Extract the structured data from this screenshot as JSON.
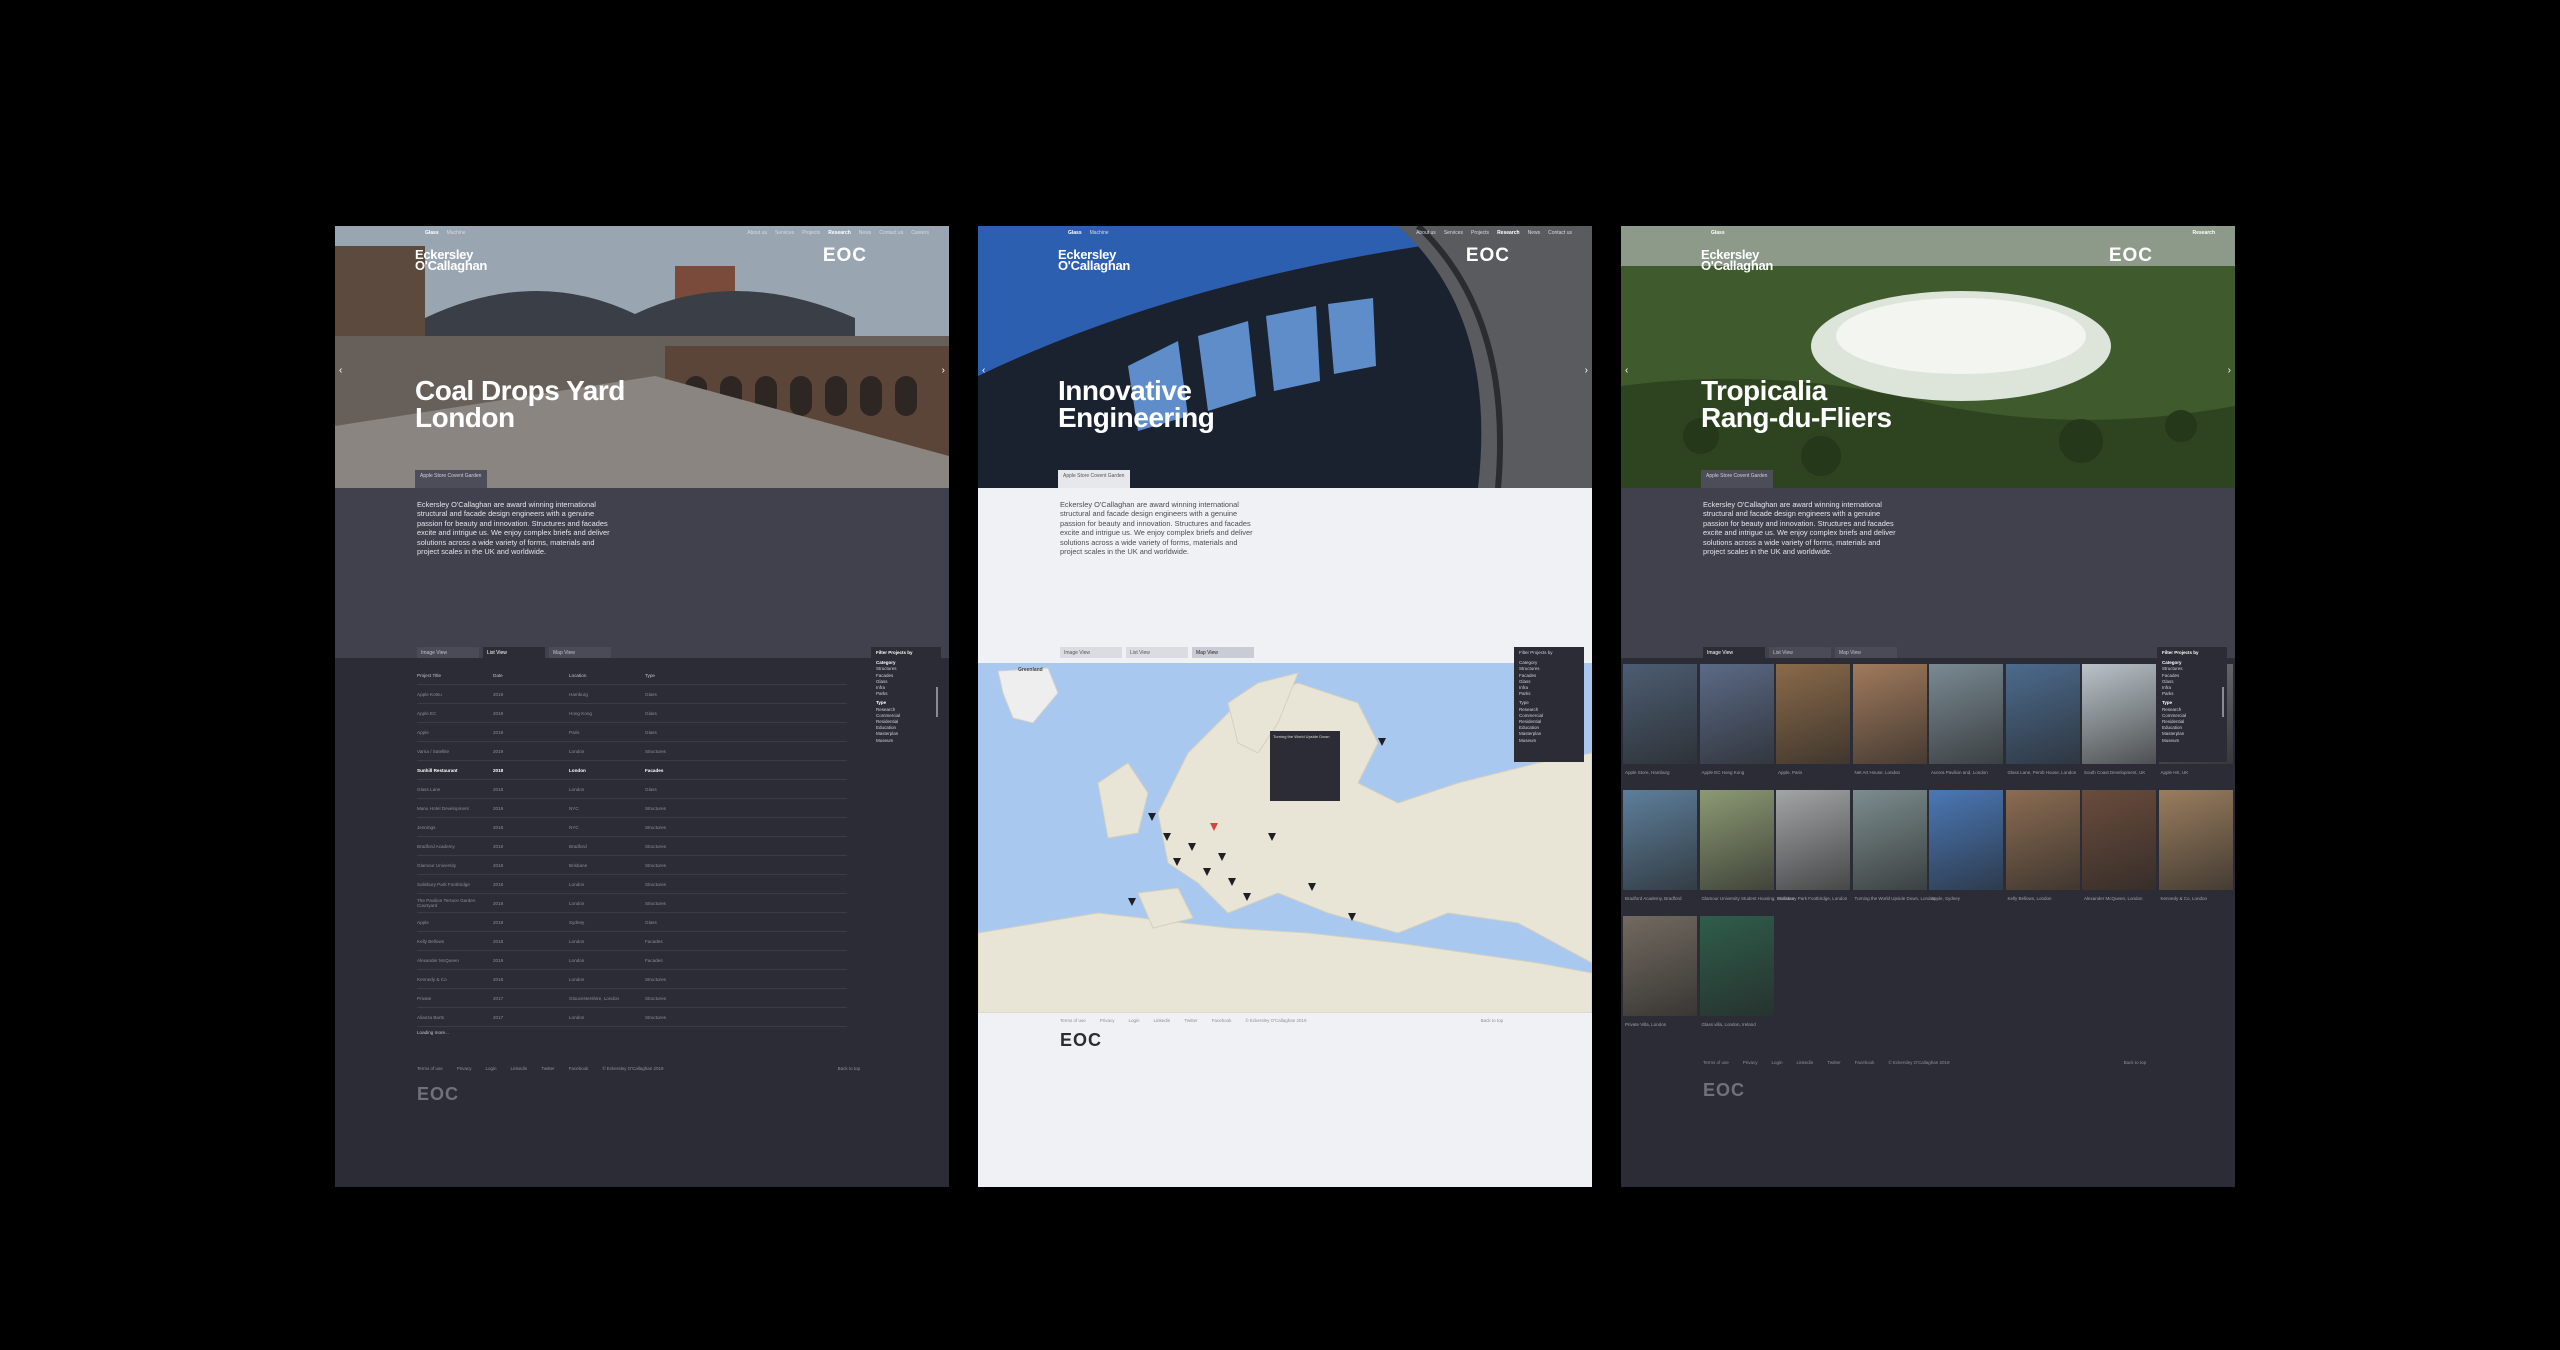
{
  "panels": [
    {
      "nav": {
        "lang": [
          "Glass",
          "Machine"
        ],
        "menu": [
          "About us",
          "Services",
          "Projects",
          "Research",
          "News",
          "Contact us",
          "Careers"
        ],
        "active_menu": "Research"
      },
      "brand": "Eckersley O'Callaghan",
      "logo": "EOC",
      "title_line1": "Coal Drops Yard",
      "title_line2": "London",
      "tag": "Apple Store Covent Garden",
      "intro": "Eckersley O'Callaghan are award winning international structural and facade design engineers with a genuine passion for beauty and innovation. Structures and facades excite and intrigue us. We enjoy complex briefs and deliver solutions across a wide variety of forms, materials and project scales in the UK and worldwide.",
      "toolbar": [
        "Image View",
        "List View",
        "Map View"
      ],
      "list": {
        "headers": [
          "Project Title",
          "Date",
          "Location",
          "Type"
        ],
        "rows": [
          [
            "Apple Kotsu",
            "2019",
            "Hamburg",
            "Glass"
          ],
          [
            "Apple EC",
            "2019",
            "Hong Kong",
            "Glass"
          ],
          [
            "Apple",
            "2019",
            "Paris",
            "Glass"
          ],
          [
            "Varna / Satellite",
            "2019",
            "London",
            "Structures"
          ],
          [
            "Sunhill Restaurant",
            "2018",
            "London",
            "Facades"
          ],
          [
            "Glass Lane",
            "2018",
            "London",
            "Glass"
          ],
          [
            "Manu Hotel Development",
            "2018",
            "NYC",
            "Structures"
          ],
          [
            "Jennings",
            "2018",
            "NYC",
            "Structures"
          ],
          [
            "Bradford Academy",
            "2018",
            "Bradford",
            "Structures"
          ],
          [
            "Glamour University",
            "2018",
            "Brisbane",
            "Structures"
          ],
          [
            "Salisbury Park Footbridge",
            "2018",
            "London",
            "Structures"
          ],
          [
            "The Pavilion Terrace Garden Courtyard",
            "2018",
            "London",
            "Structures"
          ],
          [
            "Apple",
            "2018",
            "Sydney",
            "Glass"
          ],
          [
            "Kelly Bellows",
            "2018",
            "London",
            "Facades"
          ],
          [
            "Alexander McQueen",
            "2018",
            "London",
            "Facades"
          ],
          [
            "Kennedy & Co",
            "2018",
            "London",
            "Structures"
          ],
          [
            "Private",
            "2017",
            "Gloucestershire, London",
            "Structures"
          ],
          [
            "Alianza Barts",
            "2017",
            "London",
            "Structures"
          ]
        ],
        "highlight_index": 4,
        "loading": "Loading more..."
      },
      "filter": {
        "title": "Filter Projects by",
        "groups": [
          {
            "h": "Category",
            "items": [
              "Structures",
              "Facades",
              "Glass",
              "Infra",
              "Parks"
            ]
          },
          {
            "h": "Type",
            "items": [
              "Research",
              "Commercial",
              "Residential",
              "Education",
              "Masterplan",
              "Museum"
            ]
          }
        ]
      },
      "footer": {
        "links": [
          "Terms of use",
          "Privacy",
          "Login",
          "Linkedin",
          "Twitter",
          "Facebook",
          "© Eckersley O'Callaghan 2019",
          "Back to top"
        ]
      },
      "footer_logo": "EOC"
    },
    {
      "nav": {
        "lang": [
          "Glass",
          "Machine"
        ],
        "menu": [
          "About us",
          "Services",
          "Projects",
          "Research",
          "News",
          "Contact us"
        ],
        "active_menu": "Research"
      },
      "brand": "Eckersley O'Callaghan",
      "logo": "EOC",
      "title_line1": "Innovative",
      "title_line2": "Engineering",
      "tag": "Apple Store Covent Garden",
      "intro": "Eckersley O'Callaghan are award winning international structural and facade design engineers with a genuine passion for beauty and innovation. Structures and facades excite and intrigue us. We enjoy complex briefs and deliver solutions across a wide variety of forms, materials and project scales in the UK and worldwide.",
      "toolbar": [
        "Image View",
        "List View",
        "Map View"
      ],
      "map_legend": "Greenland",
      "map_popup": "Turning the World Upside Down",
      "filter": {
        "title": "Filter Projects by",
        "groups": [
          {
            "h": "Category",
            "items": [
              "Structures",
              "Facades",
              "Glass",
              "Infra",
              "Parks"
            ]
          },
          {
            "h": "Type",
            "items": [
              "Research",
              "Commercial",
              "Residential",
              "Education",
              "Masterplan",
              "Museum"
            ]
          }
        ]
      },
      "footer": {
        "links": [
          "Terms of use",
          "Privacy",
          "Login",
          "Linkedin",
          "Twitter",
          "Facebook",
          "© Eckersley O'Callaghan 2019",
          "Back to top"
        ]
      },
      "footer_logo": "EOC"
    },
    {
      "nav": {
        "lang": [
          "Glass"
        ],
        "menu": [
          "Research"
        ],
        "active_menu": "Research"
      },
      "brand": "Eckersley O'Callaghan",
      "logo": "EOC",
      "title_line1": "Tropicalia",
      "title_line2": "Rang-du-Fliers",
      "tag": "Apple Store Covent Garden",
      "intro": "Eckersley O'Callaghan are award winning international structural and facade design engineers with a genuine passion for beauty and innovation. Structures and facades excite and intrigue us. We enjoy complex briefs and deliver solutions across a wide variety of forms, materials and project scales in the UK and worldwide.",
      "toolbar": [
        "Image View",
        "List View",
        "Map View"
      ],
      "tiles": [
        {
          "caption": "Apple Store, Hamburg",
          "color": "#4c5d72"
        },
        {
          "caption": "Apple EC Hong Kong",
          "color": "#5b6a86"
        },
        {
          "caption": "Apple, Paris",
          "color": "#8a6a4a"
        },
        {
          "caption": "Net Art House, London",
          "color": "#a07a5c"
        },
        {
          "caption": "Aurora Pavilion and, London",
          "color": "#7a8a93"
        },
        {
          "caption": "Glass Lane, Pemb House, London",
          "color": "#4c6b8e"
        },
        {
          "caption": "South Coast Development, UK",
          "color": "#b9c3c9"
        },
        {
          "caption": "Apple HK, UK",
          "color": "#6d6f75"
        },
        {
          "caption": "Bradford Academy, Bradford",
          "color": "#5d7f9b"
        },
        {
          "caption": "Glamour University Student Housing, Brisbane",
          "color": "#8c9a74"
        },
        {
          "caption": "Salisbury Park Footbridge, London",
          "color": "#a2a5a6"
        },
        {
          "caption": "Turning the World Upside Down, London",
          "color": "#7c8d8f"
        },
        {
          "caption": "Apple, Sydney",
          "color": "#4a78b6"
        },
        {
          "caption": "Kelly Bellows, London",
          "color": "#8b6c52"
        },
        {
          "caption": "Alexander McQueen, London",
          "color": "#6a4c3c"
        },
        {
          "caption": "Kennedy & Co, London",
          "color": "#9a7d5e"
        },
        {
          "caption": "Private Villa, London",
          "color": "#726a60"
        },
        {
          "caption": "Glass villa, London, Ireland",
          "color": "#2f5d4c"
        }
      ],
      "filter": {
        "title": "Filter Projects by",
        "groups": [
          {
            "h": "Category",
            "items": [
              "Structures",
              "Facades",
              "Glass",
              "Infra",
              "Parks"
            ]
          },
          {
            "h": "Type",
            "items": [
              "Research",
              "Commercial",
              "Residential",
              "Education",
              "Masterplan",
              "Museum"
            ]
          }
        ]
      },
      "footer": {
        "links": [
          "Terms of use",
          "Privacy",
          "Login",
          "Linkedin",
          "Twitter",
          "Facebook",
          "© Eckersley O'Callaghan 2019",
          "Back to top"
        ]
      },
      "footer_logo": "EOC"
    }
  ]
}
